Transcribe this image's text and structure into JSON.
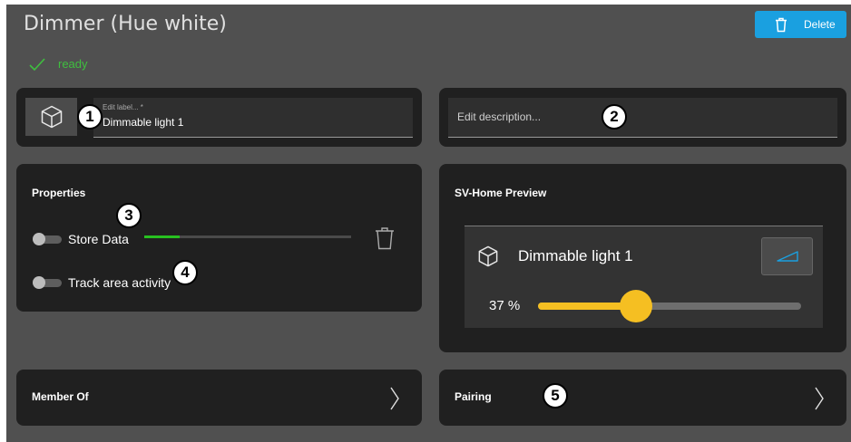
{
  "header": {
    "title": "Dimmer (Hue white)",
    "delete_label": "Delete"
  },
  "status": {
    "text": "ready",
    "color": "#3fbf3f"
  },
  "label_field": {
    "hint": "Edit label... *",
    "value": "Dimmable light 1"
  },
  "description_field": {
    "placeholder": "Edit description..."
  },
  "properties": {
    "title": "Properties",
    "items": [
      {
        "label": "Store Data",
        "enabled": false,
        "progress": 0.17
      },
      {
        "label": "Track area activity",
        "enabled": false
      }
    ]
  },
  "preview": {
    "title": "SV-Home Preview",
    "device_name": "Dimmable light 1",
    "brightness_label": "37 %",
    "brightness": 0.37
  },
  "member_of": {
    "label": "Member Of"
  },
  "pairing": {
    "label": "Pairing"
  },
  "annotations": [
    "1",
    "2",
    "3",
    "4",
    "5"
  ],
  "colors": {
    "accent": "#1aa0e0",
    "slider": "#f5bf22",
    "progress": "#28c020",
    "card": "#202020",
    "background": "#505050"
  }
}
